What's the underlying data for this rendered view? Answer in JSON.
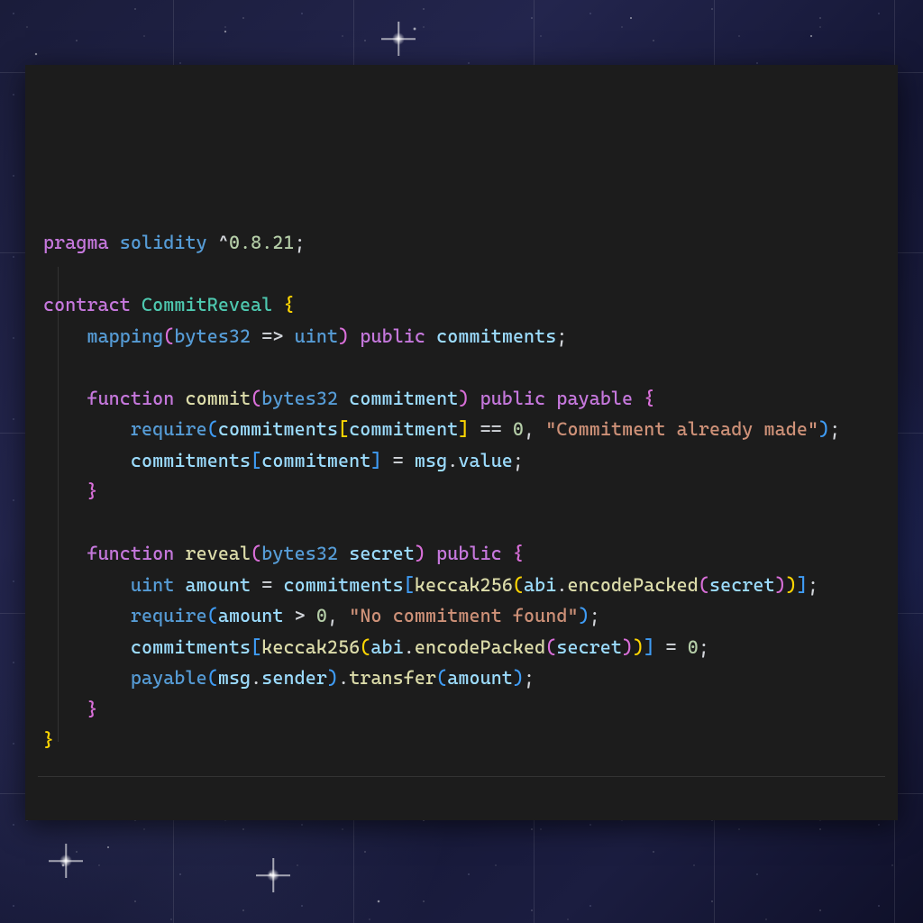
{
  "code": {
    "l1": {
      "pragma": "pragma",
      "sol": "solidity",
      "caret": "^",
      "ver": "0.8.21",
      "semi": ";"
    },
    "l3": {
      "contract": "contract",
      "name": "CommitReveal",
      "lb": "{"
    },
    "l4": {
      "mapping": "mapping",
      "lp": "(",
      "kt": "bytes32",
      "arrow": "=>",
      "vt": "uint",
      "rp": ")",
      "pub": "public",
      "var": "commitments",
      "semi": ";"
    },
    "l6": {
      "fn": "function",
      "name": "commit",
      "lp": "(",
      "pt": "bytes32",
      "pn": "commitment",
      "rp": ")",
      "pub": "public",
      "pay": "payable",
      "lb": "{"
    },
    "l7": {
      "req": "require",
      "lp": "(",
      "obj": "commitments",
      "lk": "[",
      "key": "commitment",
      "rk": "]",
      "eq": "==",
      "zero": "0",
      "comma": ",",
      "str": "\"Commitment already made\"",
      "rp": ")",
      "semi": ";"
    },
    "l8": {
      "obj": "commitments",
      "lk": "[",
      "key": "commitment",
      "rk": "]",
      "assign": "=",
      "msg": "msg",
      "dot": ".",
      "val": "value",
      "semi": ";"
    },
    "l9": {
      "rb": "}"
    },
    "l11": {
      "fn": "function",
      "name": "reveal",
      "lp": "(",
      "pt": "bytes32",
      "pn": "secret",
      "rp": ")",
      "pub": "public",
      "lb": "{"
    },
    "l12": {
      "ut": "uint",
      "var": "amount",
      "assign": "=",
      "obj": "commitments",
      "lk": "[",
      "kec": "keccak256",
      "lp": "(",
      "abi": "abi",
      "dot": ".",
      "enc": "encodePacked",
      "lp2": "(",
      "sec": "secret",
      "rp2": ")",
      "rp": ")",
      "rk": "]",
      "semi": ";"
    },
    "l13": {
      "req": "require",
      "lp": "(",
      "amt": "amount",
      "gt": ">",
      "zero": "0",
      "comma": ",",
      "str": "\"No commitment found\"",
      "rp": ")",
      "semi": ";"
    },
    "l14": {
      "obj": "commitments",
      "lk": "[",
      "kec": "keccak256",
      "lp": "(",
      "abi": "abi",
      "dot": ".",
      "enc": "encodePacked",
      "lp2": "(",
      "sec": "secret",
      "rp2": ")",
      "rp": ")",
      "rk": "]",
      "assign": "=",
      "zero": "0",
      "semi": ";"
    },
    "l15": {
      "pay": "payable",
      "lp": "(",
      "msg": "msg",
      "dot": ".",
      "snd": "sender",
      "rp": ")",
      "dot2": ".",
      "trf": "transfer",
      "lp2": "(",
      "amt": "amount",
      "rp2": ")",
      "semi": ";"
    },
    "l16": {
      "rb": "}"
    },
    "l17": {
      "rb": "}"
    }
  },
  "colors": {
    "editor_bg": "#1c1c1c",
    "keyword_decl": "#c678dd",
    "keyword_type": "#569cd6",
    "type_name": "#4ec9b0",
    "function_name": "#dcdcaa",
    "identifier": "#9cdcfe",
    "string": "#ce9178",
    "number": "#b5cea8",
    "bracket_yellow": "#ffd602",
    "bracket_pink": "#d96fd9",
    "bracket_blue": "#3f9cf5"
  }
}
